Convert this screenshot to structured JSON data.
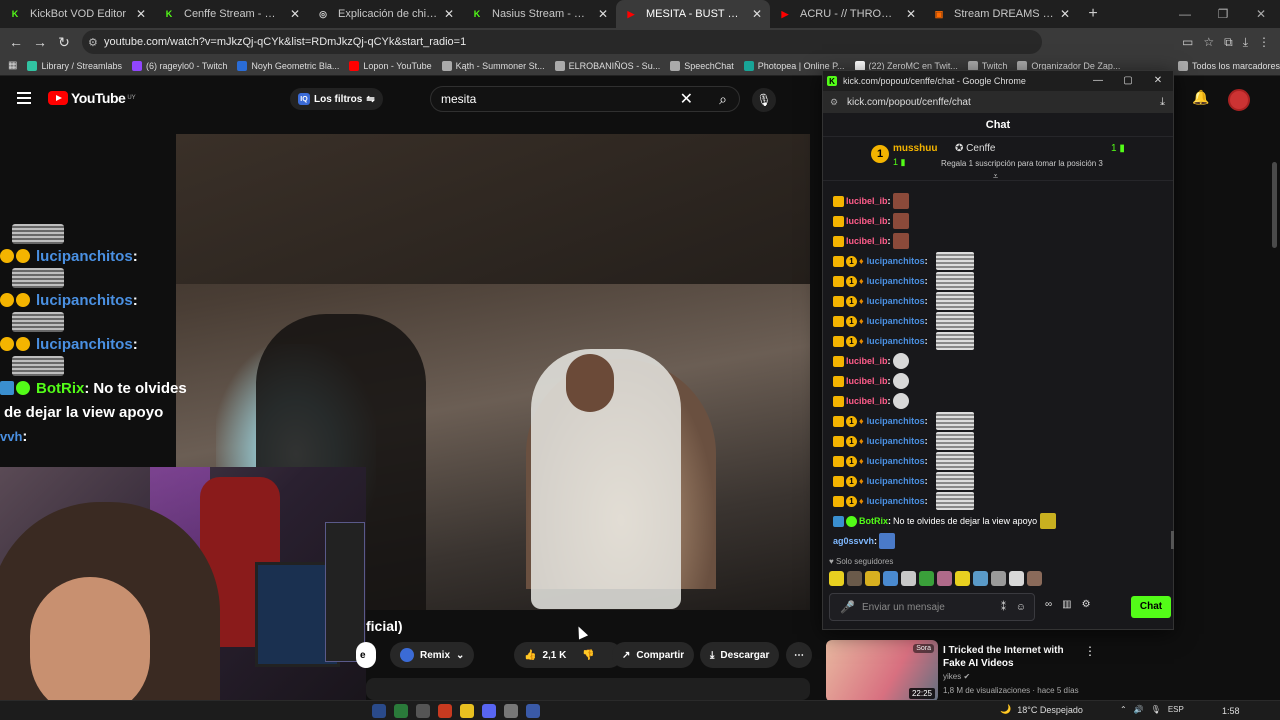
{
  "tabs": [
    {
      "title": "KickBot VOD Editor",
      "icon_color": "#53fc18",
      "glyph": "K",
      "active": false
    },
    {
      "title": "Cenffe Stream - Watch Live o",
      "icon_color": "#53fc18",
      "glyph": "K",
      "active": false
    },
    {
      "title": "Explicación de chiste absurdo",
      "icon_color": "#cfcfcf",
      "glyph": "◎",
      "active": false
    },
    {
      "title": "Nasius Stream - Watch Li",
      "icon_color": "#53fc18",
      "glyph": "K",
      "active": false
    },
    {
      "title": "MESITA - BUST DOWN (Vi",
      "icon_color": "#ff0000",
      "glyph": "▶",
      "active": true
    },
    {
      "title": "ACRU - // THROW UP SESSIO",
      "icon_color": "#ff0000",
      "glyph": "▶",
      "active": false
    },
    {
      "title": "Stream DREAMS by MOTTA |",
      "icon_color": "#ff6a00",
      "glyph": "▣",
      "active": false
    }
  ],
  "address": {
    "url": "youtube.com/watch?v=mJkzQj-qCYk&list=RDmJkzQj-qCYk&start_radio=1"
  },
  "bookmarks": [
    {
      "label": "Library / Streamlabs",
      "color": "#31c3a2"
    },
    {
      "label": "(6) rageylo0 - Twitch",
      "color": "#9146ff"
    },
    {
      "label": "Noyh Geometric Bla...",
      "color": "#2a6cd6"
    },
    {
      "label": "Lopon - YouTube",
      "color": "#ff0000"
    },
    {
      "label": "Kąth - Summoner St...",
      "color": "#aaaaaa"
    },
    {
      "label": "ELROBANIÑOS - Su...",
      "color": "#aaaaaa"
    },
    {
      "label": "SpeechChat",
      "color": "#aaaaaa"
    },
    {
      "label": "Photopea | Online P...",
      "color": "#18a497"
    },
    {
      "label": "(22) ZeroMC en Twit...",
      "color": "#ffffff"
    },
    {
      "label": "Twitch",
      "color": "#aaaaaa"
    },
    {
      "label": "Organizador De Zap...",
      "color": "#aaaaaa"
    },
    {
      "label": "Todos los marcadores",
      "color": "#aaaaaa"
    }
  ],
  "youtube": {
    "logo": "YouTube",
    "logo_region": "UY",
    "filters": "Los filtros",
    "search_value": "mesita",
    "video_title_fragment": "ficial)",
    "actions": {
      "remix": "Remix",
      "likes": "2,1 K",
      "share": "Compartir",
      "download": "Descargar",
      "partial": "e"
    },
    "suggestion": {
      "title": "I Tricked the Internet with Fake AI Videos",
      "channel": "yikes",
      "meta": "1,8 M de visualizaciones · hace 5 días",
      "duration": "22:25",
      "badge": "Sora"
    }
  },
  "overlay_chat": [
    {
      "user": "lucipanchitos",
      "sep": " :",
      "color": "#4a90e2"
    },
    {
      "user": "lucipanchitos",
      "sep": " :",
      "color": "#4a90e2"
    },
    {
      "user": "lucipanchitos",
      "sep": " :",
      "color": "#4a90e2"
    },
    {
      "user": "BotRix",
      "sep": " :",
      "text": "No te olvides",
      "color": "#53fc18"
    },
    {
      "text2": "de dejar la view apoyo"
    },
    {
      "user": "vvh",
      "sep": " :",
      "color": "#4a90e2"
    }
  ],
  "popup": {
    "window_title": "kick.com/popout/cenffe/chat - Google Chrome",
    "url": "kick.com/popout/cenffe/chat",
    "header": "Chat",
    "pinned": {
      "rank": "1",
      "user": "musshuu",
      "streamer": "Cenffe",
      "count": "1",
      "right_count": "1",
      "sub_text": "Regala 1 suscripción para tomar la posición 3"
    },
    "messages": [
      {
        "user": "lucibel_ib",
        "color": "#ff5c8a",
        "emote": "bear"
      },
      {
        "user": "lucibel_ib",
        "color": "#ff5c8a",
        "emote": "bear"
      },
      {
        "user": "lucibel_ib",
        "color": "#ff5c8a",
        "emote": "bear"
      },
      {
        "user": "lucipanchitos",
        "color": "#4a90e2",
        "emote": "stripe",
        "full": true
      },
      {
        "user": "lucipanchitos",
        "color": "#4a90e2",
        "emote": "stripe",
        "full": true
      },
      {
        "user": "lucipanchitos",
        "color": "#4a90e2",
        "emote": "stripe",
        "full": true
      },
      {
        "user": "lucipanchitos",
        "color": "#4a90e2",
        "emote": "stripe",
        "full": true
      },
      {
        "user": "lucipanchitos",
        "color": "#4a90e2",
        "emote": "stripe",
        "full": true
      },
      {
        "user": "lucibel_ib",
        "color": "#ff5c8a",
        "emote": "white"
      },
      {
        "user": "lucibel_ib",
        "color": "#ff5c8a",
        "emote": "white"
      },
      {
        "user": "lucibel_ib",
        "color": "#ff5c8a",
        "emote": "white"
      },
      {
        "user": "lucipanchitos",
        "color": "#4a90e2",
        "emote": "stripe",
        "full": true
      },
      {
        "user": "lucipanchitos",
        "color": "#4a90e2",
        "emote": "stripe",
        "full": true
      },
      {
        "user": "lucipanchitos",
        "color": "#4a90e2",
        "emote": "stripe",
        "full": true
      },
      {
        "user": "lucipanchitos",
        "color": "#4a90e2",
        "emote": "stripe",
        "full": true
      },
      {
        "user": "lucipanchitos",
        "color": "#4a90e2",
        "emote": "stripe",
        "full": true
      },
      {
        "user": "BotRix",
        "color": "#53fc18",
        "text": "No te olvides de dejar la view apoyo",
        "bot": true
      },
      {
        "user": "ag0ssvvh",
        "color": "#7fb8ff",
        "emote": "small"
      }
    ],
    "followers_only": "Solo seguidores",
    "input_placeholder": "Enviar un mensaje",
    "send": "Chat"
  },
  "taskbar": {
    "weather": "18°C  Despejado",
    "lang": "ESP",
    "time": "1:58"
  }
}
